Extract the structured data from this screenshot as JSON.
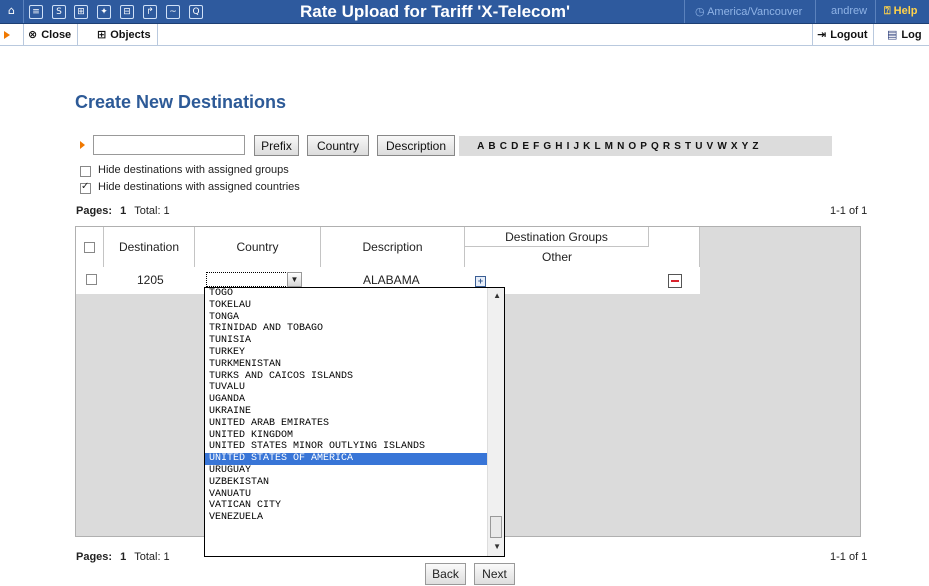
{
  "topbar": {
    "title": "Rate Upload for Tariff 'X-Telecom'",
    "timezone": "America/Vancouver",
    "user": "andrew",
    "help": "Help",
    "icons": [
      "home-icon",
      "list-icon",
      "s-icon",
      "grid-icon",
      "person-icon",
      "tree-icon",
      "arrow-icon",
      "chart-icon",
      "search-icon"
    ]
  },
  "secbar": {
    "close": "Close",
    "objects": "Objects",
    "logout": "Logout",
    "log": "Log"
  },
  "main": {
    "heading": "Create New Destinations",
    "search": {
      "value": "",
      "placeholder": ""
    },
    "buttons": {
      "prefix": "Prefix",
      "country": "Country",
      "description": "Description"
    },
    "letters": [
      "A",
      "B",
      "C",
      "D",
      "E",
      "F",
      "G",
      "H",
      "I",
      "J",
      "K",
      "L",
      "M",
      "N",
      "O",
      "P",
      "Q",
      "R",
      "S",
      "T",
      "U",
      "V",
      "W",
      "X",
      "Y",
      "Z"
    ],
    "options": [
      {
        "label": "Hide destinations with assigned groups",
        "checked": false
      },
      {
        "label": "Hide destinations with assigned countries",
        "checked": true
      }
    ],
    "pages_label": "Pages:",
    "page_num": "1",
    "total": "Total: 1",
    "count": "1-1 of 1"
  },
  "table": {
    "headers": {
      "destination": "Destination",
      "country": "Country",
      "description": "Description",
      "groups": "Destination Groups",
      "other": "Other"
    },
    "row": {
      "destination": "1205",
      "country": "",
      "description": "ALABAMA"
    }
  },
  "dropdown": {
    "items": [
      "TOGO",
      "TOKELAU",
      "TONGA",
      "TRINIDAD AND TOBAGO",
      "TUNISIA",
      "TURKEY",
      "TURKMENISTAN",
      "TURKS AND CAICOS ISLANDS",
      "TUVALU",
      "UGANDA",
      "UKRAINE",
      "UNITED ARAB EMIRATES",
      "UNITED KINGDOM",
      "UNITED STATES MINOR OUTLYING ISLANDS",
      "UNITED STATES OF AMERICA",
      "URUGUAY",
      "UZBEKISTAN",
      "VANUATU",
      "VATICAN CITY",
      "VENEZUELA"
    ],
    "selected": "UNITED STATES OF AMERICA"
  },
  "footer": {
    "back": "Back",
    "next": "Next"
  },
  "colors": {
    "topbar": "#2e5a9e",
    "heading": "#2d5a97",
    "accent": "#f07800",
    "selection": "#3875d7"
  }
}
